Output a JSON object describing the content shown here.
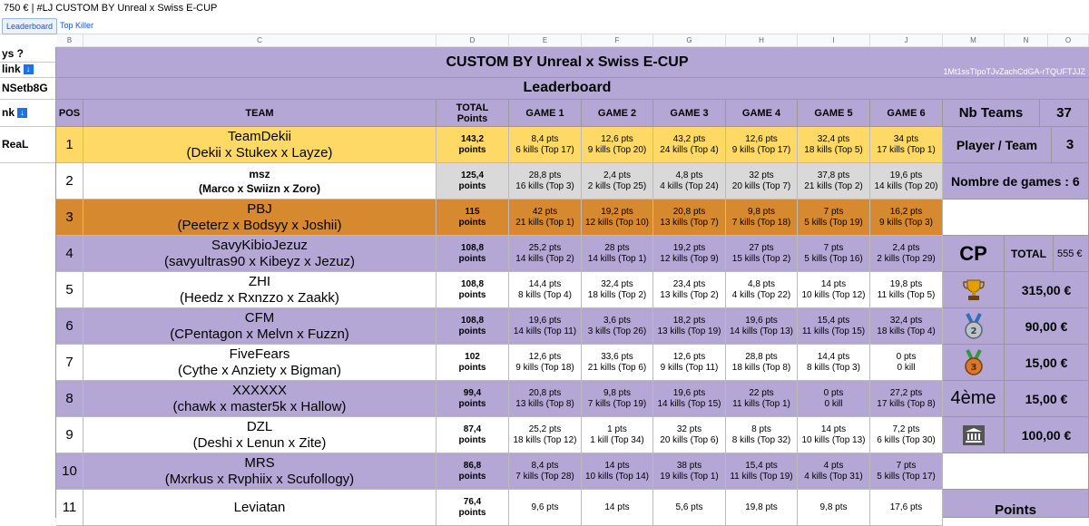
{
  "topbar": {
    "title": "750 € |  #LJ CUSTOM BY Unreal x Swiss E-CUP"
  },
  "tabs": [
    {
      "label": "Leaderboard"
    },
    {
      "label": "Top Killer"
    }
  ],
  "columns": [
    "B",
    "C",
    "D",
    "E",
    "F",
    "G",
    "H",
    "I",
    "J",
    "M",
    "N",
    "O"
  ],
  "left_col": {
    "row1": "ys ?",
    "row2": "link",
    "row3": "NSetb8G",
    "row4": "nk",
    "row5": "ReaL"
  },
  "banner": {
    "title": "CUSTOM BY Unreal x Swiss E-CUP",
    "code": "1Mt1ssTIpoTJvZachCdGA-rTQUFTJJZ"
  },
  "subtitle": "Leaderboard",
  "headers": {
    "pos": "POS",
    "team": "TEAM",
    "total": "TOTAL\nPoints",
    "games": [
      "GAME 1",
      "GAME 2",
      "GAME 3",
      "GAME 4",
      "GAME 5",
      "GAME 6"
    ]
  },
  "rows": [
    {
      "pos": "1",
      "name": "TeamDekii",
      "members": "(Dekii x Stukex x Layze)",
      "total": "143,2",
      "unit": "points",
      "color": "#ffd966",
      "games": [
        [
          "8,4 pts",
          "6 kills (Top 17)"
        ],
        [
          "12,6 pts",
          "9 kills (Top 20)"
        ],
        [
          "43,2 pts",
          "24 kills (Top 4)"
        ],
        [
          "12,6 pts",
          "9 kills (Top 17)"
        ],
        [
          "32,4 pts",
          "18 kills (Top 5)"
        ],
        [
          "34 pts",
          "17 kills (Top 1)"
        ]
      ]
    },
    {
      "pos": "2",
      "name": "msz",
      "members": "(Marco x Swiizn x Zoro)",
      "total": "125,4",
      "unit": "points",
      "color": "#ffffff",
      "alt": "#d9d9d9",
      "small": true,
      "games": [
        [
          "28,8 pts",
          "16 kills (Top 3)"
        ],
        [
          "2,4 pts",
          "2 kills (Top 25)"
        ],
        [
          "4,8 pts",
          "4 kills (Top 24)"
        ],
        [
          "32 pts",
          "20 kills (Top 7)"
        ],
        [
          "37,8 pts",
          "21 kills (Top 2)"
        ],
        [
          "19,6 pts",
          "14 kills (Top 20)"
        ]
      ]
    },
    {
      "pos": "3",
      "name": "PBJ",
      "members": "(Peeterz x Bodsyy x Joshii)",
      "total": "115",
      "unit": "points",
      "color": "#d6892f",
      "games": [
        [
          "42 pts",
          "21 kills (Top 1)"
        ],
        [
          "19,2 pts",
          "12 kills (Top 10)"
        ],
        [
          "20,8 pts",
          "13 kills (Top 7)"
        ],
        [
          "9,8 pts",
          "7 kills (Top 18)"
        ],
        [
          "7 pts",
          "5 kills (Top 19)"
        ],
        [
          "16,2 pts",
          "9 kills (Top 3)"
        ]
      ]
    },
    {
      "pos": "4",
      "name": "SavyKibioJezuz",
      "members": "(savyultras90 x Kibeyz x Jezuz)",
      "total": "108,8",
      "unit": "points",
      "color": "#b4a7d6",
      "games": [
        [
          "25,2 pts",
          "14 kills (Top 2)"
        ],
        [
          "28 pts",
          "14 kills (Top 1)"
        ],
        [
          "19,2 pts",
          "12 kills (Top 9)"
        ],
        [
          "27 pts",
          "15 kills (Top 2)"
        ],
        [
          "7 pts",
          "5 kills (Top 16)"
        ],
        [
          "2,4 pts",
          "2 kills (Top 29)"
        ]
      ]
    },
    {
      "pos": "5",
      "name": "ZHI",
      "members": "(Heedz x Rxnzzo x Zaakk)",
      "total": "108,8",
      "unit": "points",
      "color": "#ffffff",
      "games": [
        [
          "14,4 pts",
          "8 kills (Top 4)"
        ],
        [
          "32,4 pts",
          "18 kills (Top 2)"
        ],
        [
          "23,4 pts",
          "13 kills (Top 2)"
        ],
        [
          "4,8 pts",
          "4 kills (Top 22)"
        ],
        [
          "14 pts",
          "10 kills (Top 12)"
        ],
        [
          "19,8 pts",
          "11 kills (Top 5)"
        ]
      ]
    },
    {
      "pos": "6",
      "name": "CFM",
      "members": "(CPentagon x Melvn x Fuzzn)",
      "total": "108,8",
      "unit": "points",
      "color": "#b4a7d6",
      "games": [
        [
          "19,6 pts",
          "14 kills (Top 11)"
        ],
        [
          "3,6 pts",
          "3 kills (Top 26)"
        ],
        [
          "18,2 pts",
          "13 kills (Top 19)"
        ],
        [
          "19,6 pts",
          "14 kills (Top 13)"
        ],
        [
          "15,4 pts",
          "11 kills (Top 15)"
        ],
        [
          "32,4 pts",
          "18 kills (Top 4)"
        ]
      ]
    },
    {
      "pos": "7",
      "name": "FiveFears",
      "members": "(Cythe x Anziety x Bigman)",
      "total": "102",
      "unit": "points",
      "color": "#ffffff",
      "games": [
        [
          "12,6 pts",
          "9 kills (Top 18)"
        ],
        [
          "33,6 pts",
          "21 kills (Top 6)"
        ],
        [
          "12,6 pts",
          "9 kills (Top 11)"
        ],
        [
          "28,8 pts",
          "18 kills (Top 8)"
        ],
        [
          "14,4 pts",
          "8 kills (Top 3)"
        ],
        [
          "0 pts",
          "0 kill"
        ]
      ]
    },
    {
      "pos": "8",
      "name": "XXXXXX",
      "members": "(chawk x master5k x Hallow)",
      "total": "99,4",
      "unit": "points",
      "color": "#b4a7d6",
      "games": [
        [
          "20,8 pts",
          "13 kills (Top 8)"
        ],
        [
          "9,8 pts",
          "7 kills (Top 19)"
        ],
        [
          "19,6 pts",
          "14 kills (Top 15)"
        ],
        [
          "22 pts",
          "11 kills (Top 1)"
        ],
        [
          "0 pts",
          "0 kill"
        ],
        [
          "27,2 pts",
          "17 kills (Top 8)"
        ]
      ]
    },
    {
      "pos": "9",
      "name": "DZL",
      "members": "(Deshi x Lenun x Zite)",
      "total": "87,4",
      "unit": "points",
      "color": "#ffffff",
      "games": [
        [
          "25,2 pts",
          "18 kills (Top 12)"
        ],
        [
          "1 pts",
          "1 kill (Top 34)"
        ],
        [
          "32 pts",
          "20 kills (Top 6)"
        ],
        [
          "8 pts",
          "8 kills (Top 32)"
        ],
        [
          "14 pts",
          "10 kills (Top 13)"
        ],
        [
          "7,2 pts",
          "6 kills (Top 30)"
        ]
      ]
    },
    {
      "pos": "10",
      "name": "MRS",
      "members": "(Mxrkus x Rvphiix x Scufollogy)",
      "total": "86,8",
      "unit": "points",
      "color": "#b4a7d6",
      "games": [
        [
          "8,4 pts",
          "7 kills (Top 28)"
        ],
        [
          "14 pts",
          "10 kills (Top 14)"
        ],
        [
          "38 pts",
          "19 kills (Top 1)"
        ],
        [
          "15,4 pts",
          "11 kills (Top 19)"
        ],
        [
          "4 pts",
          "4 kills (Top 31)"
        ],
        [
          "7 pts",
          "5 kills (Top 17)"
        ]
      ]
    },
    {
      "pos": "11",
      "name": "Leviatan",
      "members": "",
      "total": "76,4",
      "unit": "points",
      "color": "#ffffff",
      "games": [
        [
          "9,6 pts",
          ""
        ],
        [
          "14 pts",
          ""
        ],
        [
          "5,6 pts",
          ""
        ],
        [
          "19,8 pts",
          ""
        ],
        [
          "9,8 pts",
          ""
        ],
        [
          "17,6 pts",
          ""
        ]
      ]
    }
  ],
  "side": {
    "nb_teams_label": "Nb Teams",
    "nb_teams_value": "37",
    "player_team_label": "Player / Team",
    "player_team_value": "3",
    "nb_games_label": "Nombre de games : 6",
    "cp_label": "CP",
    "total_label": "TOTAL",
    "total_value": "555 €",
    "prizes": [
      {
        "icon": "trophy-icon",
        "amount": "315,00 €"
      },
      {
        "icon": "silver-medal-icon",
        "amount": "90,00 €"
      },
      {
        "icon": "bronze-medal-icon",
        "amount": "15,00 €"
      },
      {
        "label": "4ème",
        "amount": "15,00 €"
      },
      {
        "icon": "bank-icon",
        "amount": "100,00 €"
      }
    ],
    "points_label": "Points"
  }
}
